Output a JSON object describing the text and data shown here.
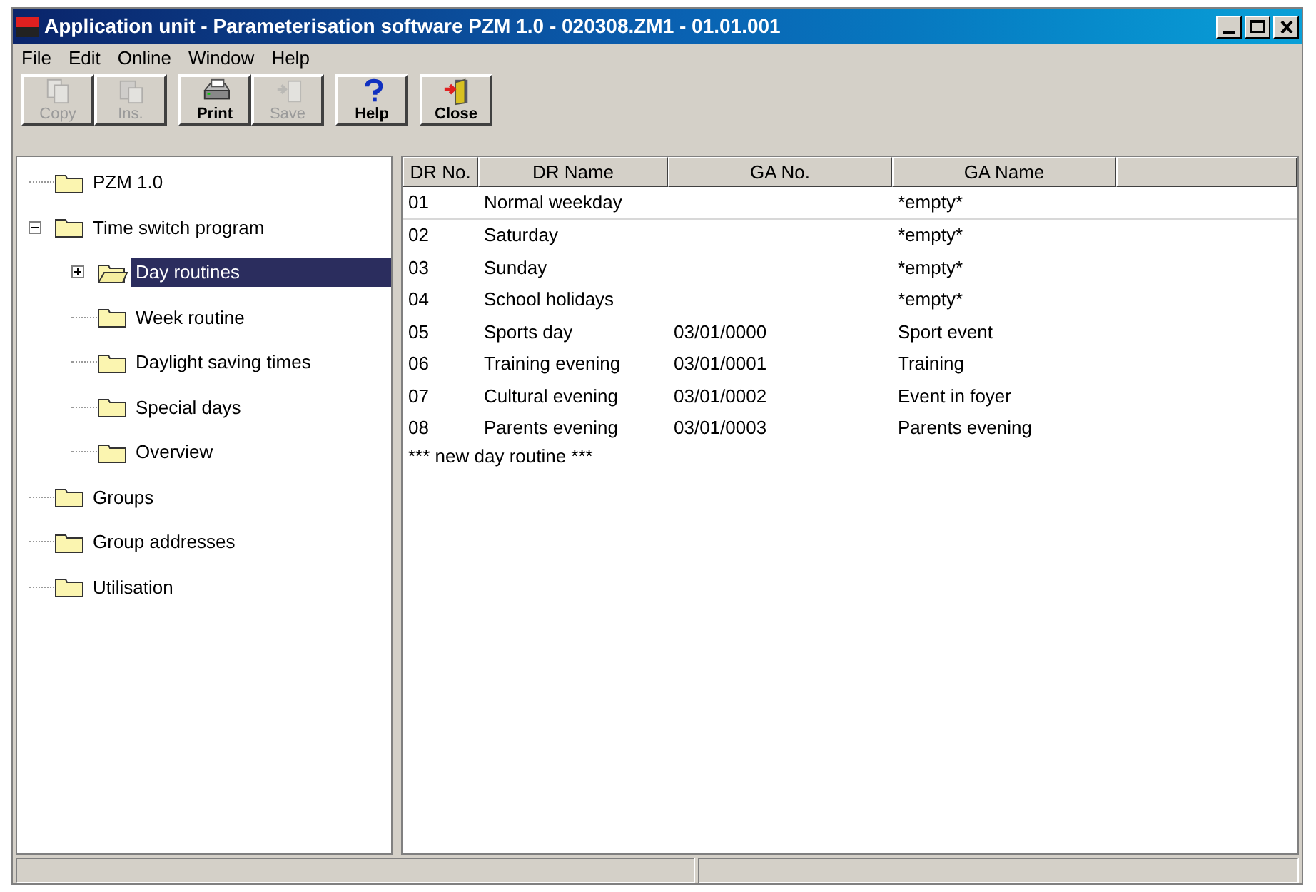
{
  "window": {
    "title": "Application unit - Parameterisation software PZM 1.0 - 020308.ZM1 - 01.01.001"
  },
  "menu": [
    "File",
    "Edit",
    "Online",
    "Window",
    "Help"
  ],
  "toolbar": [
    {
      "label": "Copy",
      "kind": "copy",
      "disabled": true
    },
    {
      "label": "Ins.",
      "kind": "insert",
      "disabled": true
    },
    {
      "label": "Print",
      "kind": "print",
      "disabled": false
    },
    {
      "label": "Save",
      "kind": "save",
      "disabled": true
    },
    {
      "label": "Help",
      "kind": "help",
      "disabled": false
    },
    {
      "label": "Close",
      "kind": "close",
      "disabled": false
    }
  ],
  "tree": [
    {
      "label": "PZM 1.0",
      "selected": false
    },
    {
      "label": "Time switch program",
      "selected": false,
      "expanded": true,
      "children": [
        {
          "label": "Day routines",
          "selected": true,
          "expanded": false
        },
        {
          "label": "Week routine",
          "selected": false
        },
        {
          "label": "Daylight saving times",
          "selected": false
        },
        {
          "label": "Special days",
          "selected": false
        },
        {
          "label": "Overview",
          "selected": false
        }
      ]
    },
    {
      "label": "Groups",
      "selected": false
    },
    {
      "label": "Group addresses",
      "selected": false
    },
    {
      "label": "Utilisation",
      "selected": false
    }
  ],
  "table": {
    "columns": [
      "DR No.",
      "DR Name",
      "GA No.",
      "GA Name"
    ],
    "rows": [
      [
        "01",
        "Normal weekday",
        "",
        "*empty*"
      ],
      [
        "02",
        "Saturday",
        "",
        "*empty*"
      ],
      [
        "03",
        "Sunday",
        "",
        "*empty*"
      ],
      [
        "04",
        "School holidays",
        "",
        "*empty*"
      ],
      [
        "05",
        "Sports day",
        "03/01/0000",
        "Sport event"
      ],
      [
        "06",
        "Training evening",
        "03/01/0001",
        "Training"
      ],
      [
        "07",
        "Cultural evening",
        "03/01/0002",
        "Event in foyer"
      ],
      [
        "08",
        "Parents evening",
        "03/01/0003",
        "Parents evening"
      ]
    ],
    "new_row": "*** new day routine ***"
  }
}
